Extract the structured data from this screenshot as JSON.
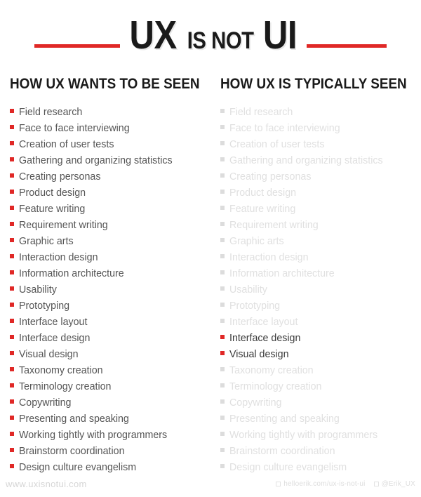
{
  "title": {
    "part1": "UX",
    "part2": "IS NOT",
    "part3": "UI",
    "rule_color": "#e02826"
  },
  "columns": [
    {
      "heading": "HOW UX WANTS TO BE SEEN",
      "items": [
        {
          "label": "Field research",
          "state": "active"
        },
        {
          "label": "Face to face interviewing",
          "state": "active"
        },
        {
          "label": "Creation of user tests",
          "state": "active"
        },
        {
          "label": "Gathering and organizing statistics",
          "state": "active"
        },
        {
          "label": "Creating personas",
          "state": "active"
        },
        {
          "label": "Product design",
          "state": "active"
        },
        {
          "label": "Feature writing",
          "state": "active"
        },
        {
          "label": "Requirement writing",
          "state": "active"
        },
        {
          "label": "Graphic arts",
          "state": "active"
        },
        {
          "label": "Interaction design",
          "state": "active"
        },
        {
          "label": "Information architecture",
          "state": "active"
        },
        {
          "label": "Usability",
          "state": "active"
        },
        {
          "label": "Prototyping",
          "state": "active"
        },
        {
          "label": "Interface layout",
          "state": "active"
        },
        {
          "label": "Interface design",
          "state": "active"
        },
        {
          "label": "Visual design",
          "state": "active"
        },
        {
          "label": "Taxonomy creation",
          "state": "active"
        },
        {
          "label": "Terminology creation",
          "state": "active"
        },
        {
          "label": "Copywriting",
          "state": "active"
        },
        {
          "label": "Presenting and speaking",
          "state": "active"
        },
        {
          "label": "Working tightly with programmers",
          "state": "active"
        },
        {
          "label": "Brainstorm coordination",
          "state": "active"
        },
        {
          "label": "Design culture evangelism",
          "state": "active"
        }
      ]
    },
    {
      "heading": "HOW UX IS TYPICALLY SEEN",
      "items": [
        {
          "label": "Field research",
          "state": "faded"
        },
        {
          "label": "Face to face interviewing",
          "state": "faded"
        },
        {
          "label": "Creation of user tests",
          "state": "faded"
        },
        {
          "label": "Gathering and organizing statistics",
          "state": "faded"
        },
        {
          "label": "Creating personas",
          "state": "faded"
        },
        {
          "label": "Product design",
          "state": "faded"
        },
        {
          "label": "Feature writing",
          "state": "faded"
        },
        {
          "label": "Requirement writing",
          "state": "faded"
        },
        {
          "label": "Graphic arts",
          "state": "faded"
        },
        {
          "label": "Interaction design",
          "state": "faded"
        },
        {
          "label": "Information architecture",
          "state": "faded"
        },
        {
          "label": "Usability",
          "state": "faded"
        },
        {
          "label": "Prototyping",
          "state": "faded"
        },
        {
          "label": "Interface layout",
          "state": "faded"
        },
        {
          "label": "Interface design",
          "state": "highlight"
        },
        {
          "label": "Visual design",
          "state": "highlight"
        },
        {
          "label": "Taxonomy creation",
          "state": "faded"
        },
        {
          "label": "Terminology creation",
          "state": "faded"
        },
        {
          "label": "Copywriting",
          "state": "faded"
        },
        {
          "label": "Presenting and speaking",
          "state": "faded"
        },
        {
          "label": "Working tightly with programmers",
          "state": "faded"
        },
        {
          "label": "Brainstorm coordination",
          "state": "faded"
        },
        {
          "label": "Design culture evangelism",
          "state": "faded"
        }
      ]
    }
  ],
  "footer": {
    "site": "www.uxisnotui.com",
    "links": [
      {
        "icon": "link-icon",
        "label": "helloerik.com/ux-is-not-ui"
      },
      {
        "icon": "twitter-icon",
        "label": "@Erik_UX"
      }
    ]
  }
}
